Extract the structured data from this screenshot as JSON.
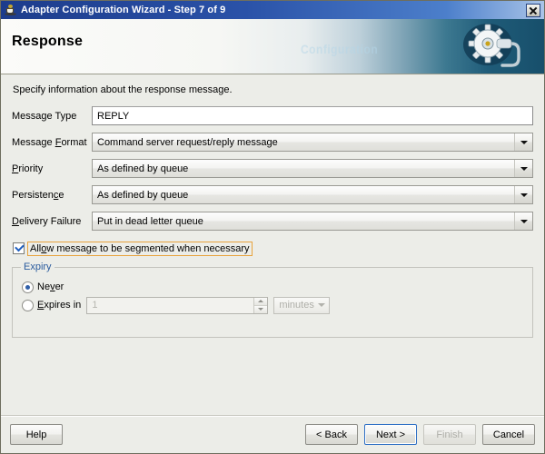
{
  "window": {
    "title": "Adapter Configuration Wizard - Step 7 of 9",
    "icon": "coffee-cup-icon",
    "close_label": "✕"
  },
  "banner": {
    "heading": "Response",
    "ghost_text": "Configuration",
    "gradient_start": "#FBFBF9",
    "gradient_end": "#174F6B"
  },
  "content": {
    "intro": "Specify information about the response message.",
    "fields": [
      {
        "label_pre": "Message Type",
        "label_mn": "",
        "label_post": "",
        "type": "text",
        "value": "REPLY"
      },
      {
        "label_pre": "Message ",
        "label_mn": "F",
        "label_post": "ormat",
        "type": "combo",
        "value": "Command server request/reply message"
      },
      {
        "label_pre": "",
        "label_mn": "P",
        "label_post": "riority",
        "type": "combo",
        "value": "As defined by queue"
      },
      {
        "label_pre": "Persisten",
        "label_mn": "c",
        "label_post": "e",
        "type": "combo",
        "value": "As defined by queue"
      },
      {
        "label_pre": "",
        "label_mn": "D",
        "label_post": "elivery Failure",
        "type": "combo",
        "value": "Put in dead letter queue"
      }
    ],
    "segment_checkbox": {
      "checked": true,
      "label_pre": "All",
      "label_mn": "o",
      "label_post": "w message to be segmented when necessary",
      "focus_color": "#E8A33D"
    },
    "expiry": {
      "legend": "Expiry",
      "legend_color": "#2B5C9E",
      "never": {
        "label_pre": "Ne",
        "label_mn": "v",
        "label_post": "er",
        "selected": true
      },
      "expires_in": {
        "label_pre": "",
        "label_mn": "E",
        "label_post": "xpires in",
        "selected": false,
        "value": "1",
        "unit": "minutes",
        "enabled": false
      }
    }
  },
  "footer": {
    "help": "Help",
    "back": "< Back",
    "next": "Next >",
    "finish": "Finish",
    "cancel": "Cancel",
    "focused_button": "next",
    "disabled_button": "finish"
  }
}
